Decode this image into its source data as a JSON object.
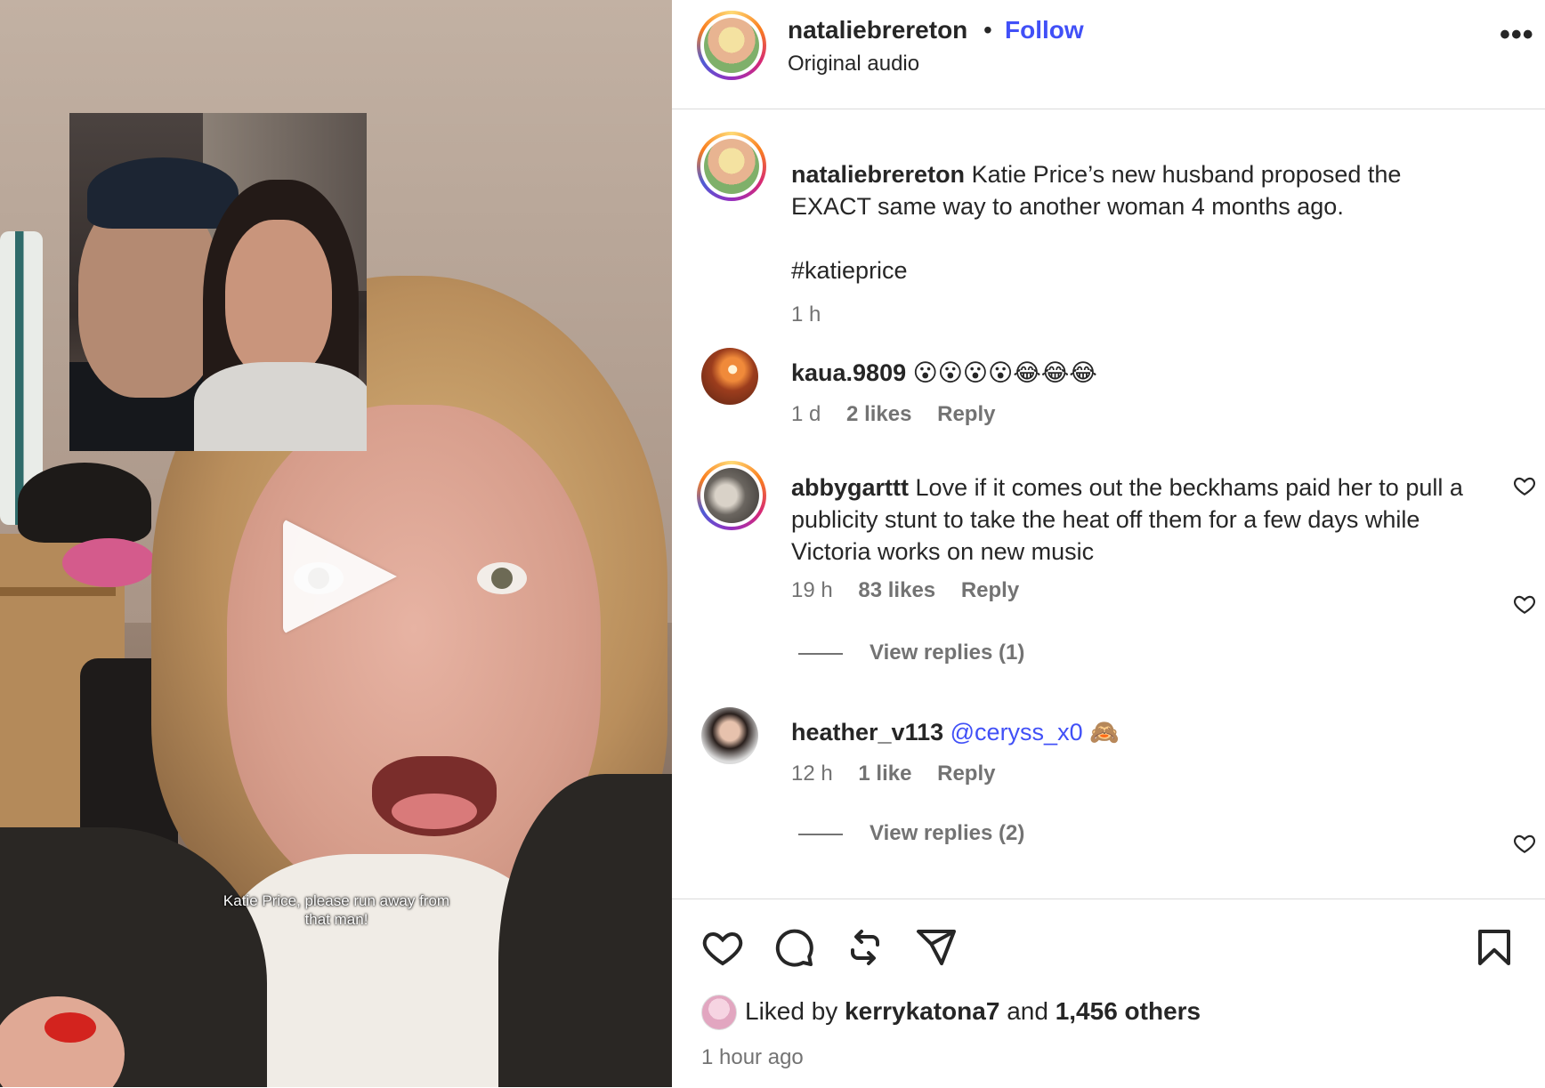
{
  "video": {
    "caption": "Katie Price, please run away from that man!"
  },
  "header": {
    "username": "nataliebrereton",
    "separator": "•",
    "follow_label": "Follow",
    "audio": "Original audio",
    "more": "•••"
  },
  "post": {
    "username": "nataliebrereton",
    "text": "Katie Price’s new husband proposed the EXACT same way to another woman 4 months ago.",
    "hashtag": "#katieprice",
    "time": "1 h"
  },
  "comments": [
    {
      "username": "kaua.9809",
      "text": "😮😮😮😮😂😂😂",
      "time": "1 d",
      "likes": "2 likes",
      "reply": "Reply"
    },
    {
      "username": "abbygarttt",
      "text": "Love if it comes out the beckhams paid her to pull a publicity stunt to take the heat off them for a few days while Victoria works on new music",
      "time": "19 h",
      "likes": "83 likes",
      "reply": "Reply",
      "view_replies": "View replies (1)"
    },
    {
      "username": "heather_v113",
      "mention": "@ceryss_x0",
      "text": "🙈",
      "time": "12 h",
      "likes": "1 like",
      "reply": "Reply",
      "view_replies": "View replies (2)"
    }
  ],
  "footer": {
    "liked_by_prefix": "Liked by",
    "liked_by_user": "kerrykatona7",
    "and": "and",
    "others": "1,456 others",
    "time_ago": "1 hour ago"
  },
  "icons": {
    "like": "heart-icon",
    "comment": "comment-bubble-icon",
    "repost": "repost-icon",
    "share": "paper-plane-icon",
    "save": "bookmark-icon",
    "play": "play-icon"
  },
  "colors": {
    "link": "#4150f7",
    "muted": "#737373",
    "text": "#262626"
  }
}
